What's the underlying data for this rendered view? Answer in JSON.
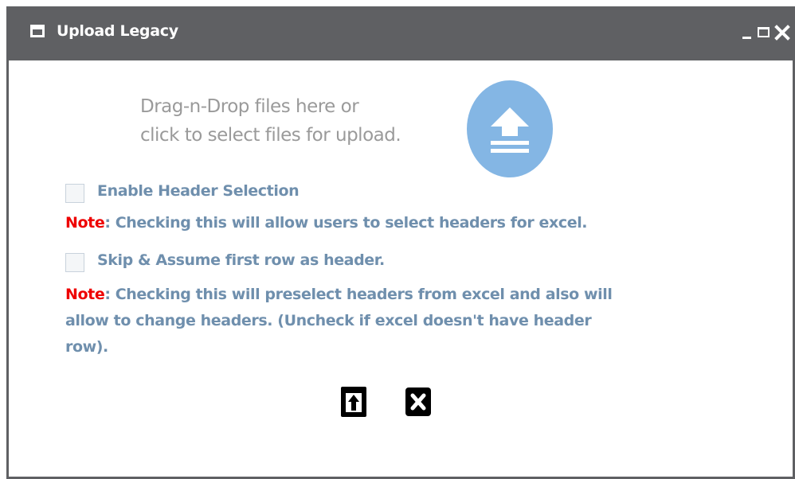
{
  "window": {
    "title": "Upload Legacy",
    "icons": {
      "window": "window-icon",
      "minimize": "minimize-icon",
      "maximize": "maximize-icon",
      "close": "close-icon"
    }
  },
  "dropzone": {
    "line1": "Drag-n-Drop files here or",
    "line2": "click to select files for upload.",
    "icon": "upload-arrow-icon"
  },
  "options": [
    {
      "label": "Enable Header Selection",
      "checked": false,
      "note_keyword": "Note",
      "note_text": ": Checking this will allow users to select headers for excel."
    },
    {
      "label": "Skip & Assume first row as header.",
      "checked": false,
      "note_keyword": "Note",
      "note_text": ": Checking this will preselect headers from excel and also will",
      "note_text_line2": "allow to change headers. (Uncheck if excel doesn't have header",
      "note_text_line3": "row)."
    }
  ],
  "actions": {
    "upload_icon": "upload-icon",
    "cancel_icon": "cancel-icon"
  },
  "colors": {
    "titlebar": "#5f6063",
    "label": "#6f8fad",
    "note_keyword": "#ee0000",
    "dropzone_text": "#9a9a9a",
    "upload_circle": "#84b6e4"
  }
}
